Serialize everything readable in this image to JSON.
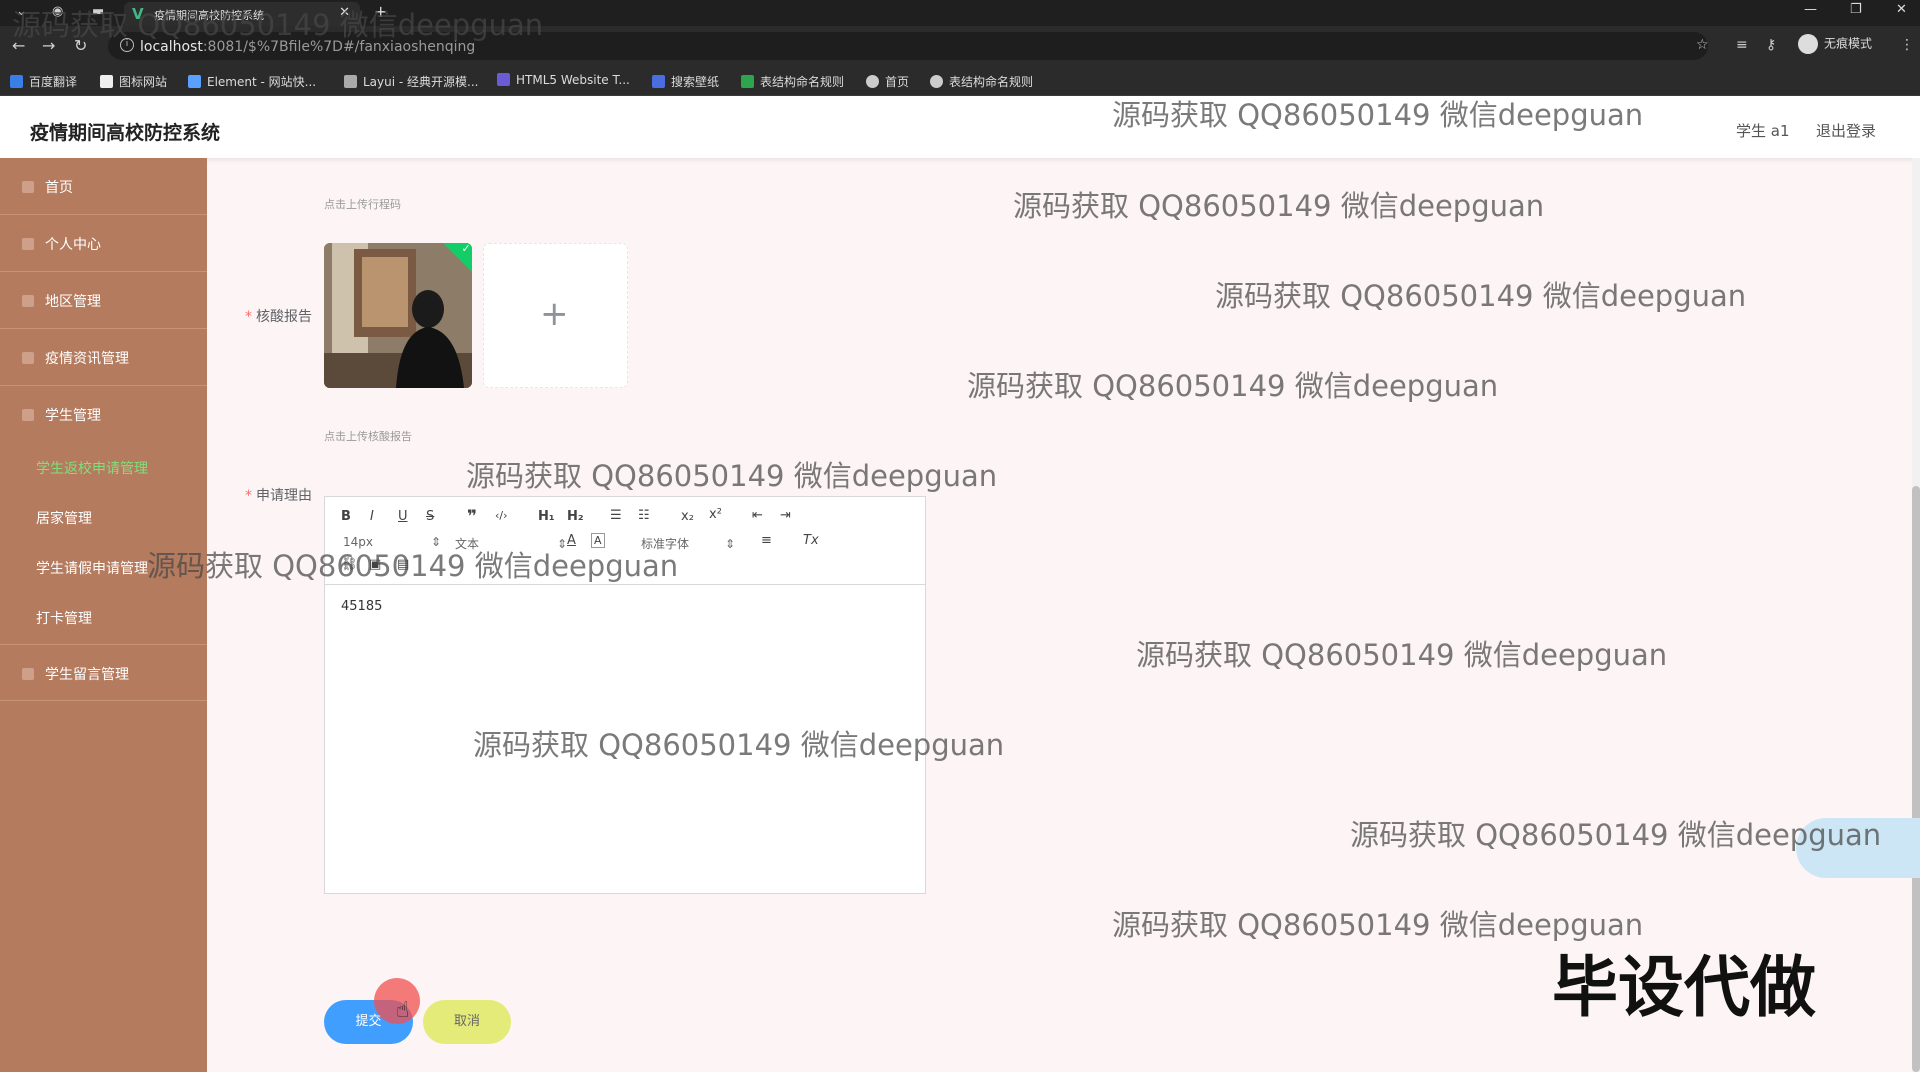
{
  "browser": {
    "tab_title": "疫情期间高校防控系统",
    "url_host": "localhost",
    "url_path": ":8081/$%7Bfile%7D#/fanxiaoshenqing",
    "profile_label": "无痕模式",
    "bookmarks": [
      "百度翻译",
      "图标网站",
      "Element - 网站快...",
      "Layui - 经典开源模...",
      "HTML5 Website T...",
      "搜索壁纸",
      "表结构命名规则",
      "首页",
      "表结构命名规则"
    ]
  },
  "header": {
    "title": "疫情期间高校防控系统",
    "user": "学生 a1",
    "logout": "退出登录"
  },
  "sidebar": {
    "items": [
      {
        "label": "首页"
      },
      {
        "label": "个人中心"
      },
      {
        "label": "地区管理"
      },
      {
        "label": "疫情资讯管理"
      },
      {
        "label": "学生管理"
      }
    ],
    "subitems": [
      {
        "label": "学生返校申请管理"
      },
      {
        "label": "居家管理"
      },
      {
        "label": "学生请假申请管理"
      },
      {
        "label": "打卡管理"
      }
    ],
    "last_item": "学生留言管理"
  },
  "form": {
    "travel_code_hint": "点击上传行程码",
    "report_label": "核酸报告",
    "report_hint": "点击上传核酸报告",
    "reason_label": "申请理由",
    "editor": {
      "font_size": "14px",
      "paragraph": "文本",
      "font_family": "标准字体",
      "content": "45185"
    },
    "submit_label": "提交",
    "cancel_label": "取消"
  },
  "watermark": "源码获取 QQ86050149 微信deepguan",
  "stamp": "毕设代做"
}
